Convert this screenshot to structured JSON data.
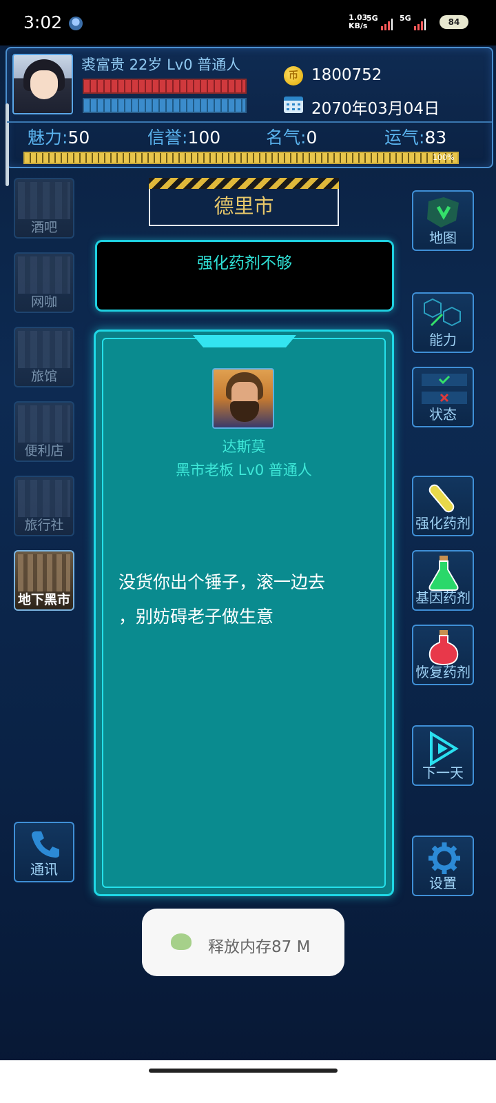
{
  "status_bar": {
    "time": "3:02",
    "speed_value": "1.03",
    "speed_unit": "KB/s",
    "net1": "5G",
    "net2": "5G",
    "battery": "84"
  },
  "player": {
    "name_line": "裘富贵 22岁 Lv0 普通人",
    "money": "1800752",
    "date": "2070年03月04日",
    "stats": [
      {
        "label": "魅力",
        "value": "50"
      },
      {
        "label": "信誉",
        "value": "100"
      },
      {
        "label": "名气",
        "value": "0"
      },
      {
        "label": "运气",
        "value": "83"
      }
    ],
    "progress_text": "100%",
    "progress_value": 1.0
  },
  "city": "德里市",
  "message": "强化药剂不够",
  "locations": [
    {
      "label": "酒吧"
    },
    {
      "label": "网咖"
    },
    {
      "label": "旅馆"
    },
    {
      "label": "便利店"
    },
    {
      "label": "旅行社"
    },
    {
      "label": "地下黑市"
    }
  ],
  "actions": [
    {
      "label": "地图"
    },
    {
      "label": "能力"
    },
    {
      "label": "状态"
    },
    {
      "label": "强化药剂"
    },
    {
      "label": "基因药剂"
    },
    {
      "label": "恢复药剂"
    },
    {
      "label": "下一天"
    },
    {
      "label": "设置"
    }
  ],
  "comm_label": "通讯",
  "npc": {
    "name": "达斯莫",
    "title": "黑市老板 Lv0 普通人",
    "dialog_line1": "没货你出个锤子，滚一边去",
    "dialog_line2": "，别妨碍老子做生意"
  },
  "toast": "释放内存87 M",
  "colors": {
    "accent_cyan": "#1fd8e6",
    "card_teal": "#0a8b8f",
    "gold_text": "#e8c86a",
    "stat_label": "#5ab3ee"
  }
}
